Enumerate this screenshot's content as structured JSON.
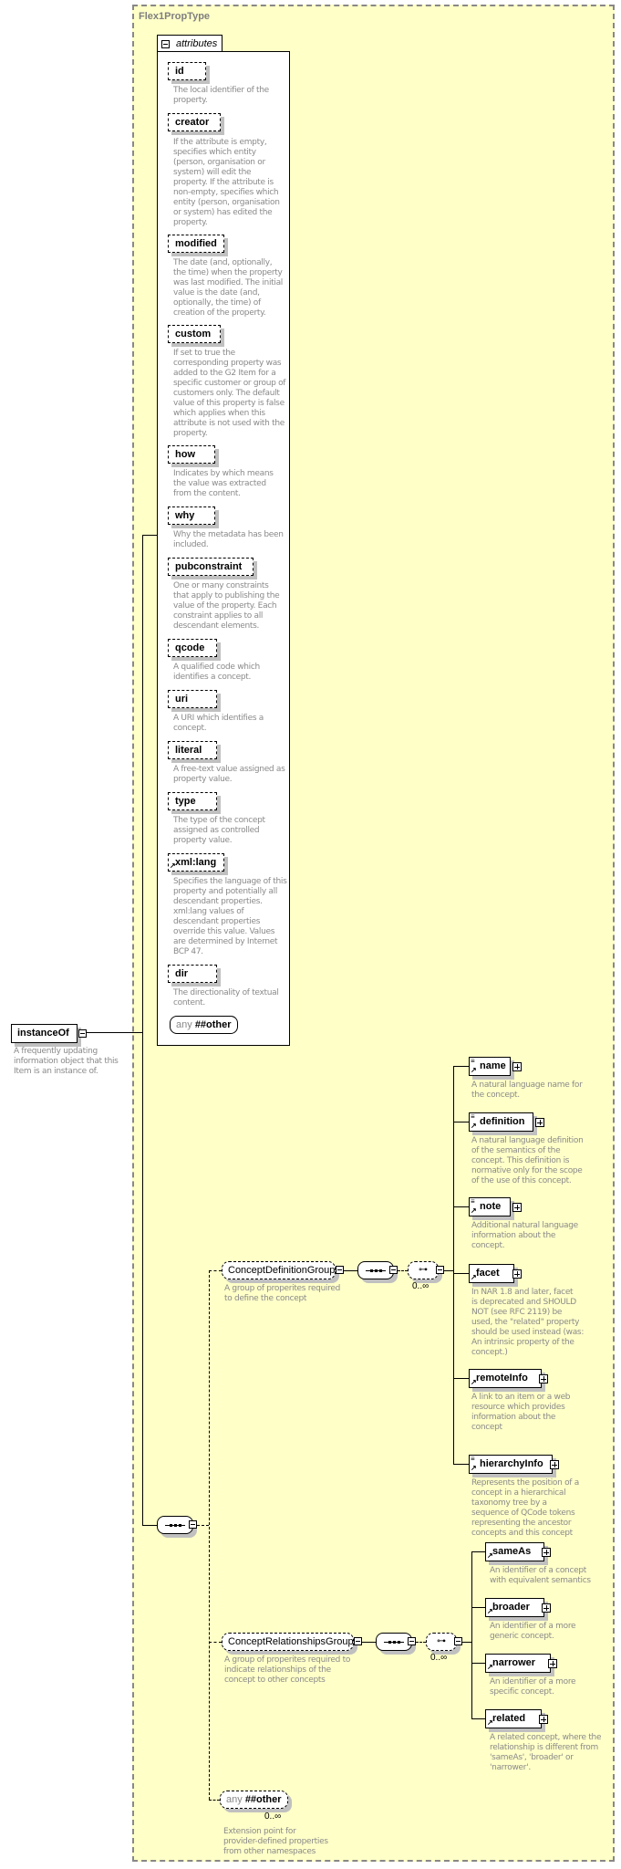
{
  "panel": {
    "title": "Flex1PropType"
  },
  "root": {
    "name": "instanceOf",
    "description": "A frequently updating\ninformation object that this\nItem is an instance of."
  },
  "attributes": {
    "label": "attributes",
    "items": [
      {
        "name": "id",
        "description": "The local identifier of the\nproperty."
      },
      {
        "name": "creator",
        "description": "If the attribute is empty,\nspecifies which entity\n(person, organisation or\nsystem) will edit the\nproperty. If the attribute is\nnon-empty, specifies which\nentity (person, organisation\nor system) has edited the\nproperty."
      },
      {
        "name": "modified",
        "description": "The date (and, optionally,\nthe time) when the property\nwas last modified. The initial\nvalue is the date (and,\noptionally, the time) of\ncreation of the property."
      },
      {
        "name": "custom",
        "description": "If set to true the\ncorresponding property was\nadded to the G2 Item for a\nspecific customer or group of\ncustomers only. The default\nvalue of this property is false\nwhich applies when this\nattribute is not used with the\nproperty."
      },
      {
        "name": "how",
        "description": "Indicates by which means\nthe value was extracted\nfrom the content."
      },
      {
        "name": "why",
        "description": "Why the metadata has been\nincluded."
      },
      {
        "name": "pubconstraint",
        "description": "One or many constraints\nthat apply to publishing the\nvalue of the property. Each\nconstraint applies to all\ndescendant elements."
      },
      {
        "name": "qcode",
        "description": "A qualified code which\nidentifies a concept."
      },
      {
        "name": "uri",
        "description": "A URI which identifies a\nconcept."
      },
      {
        "name": "literal",
        "description": "A free-text value assigned as\nproperty value."
      },
      {
        "name": "type",
        "description": "The type of the concept\nassigned as controlled\nproperty value."
      },
      {
        "name": "xml:lang",
        "description": "Specifies the language of this\nproperty and potentially all\ndescendant properties.\nxml:lang values of\ndescendant properties\noverride this value. Values\nare determined by Internet\nBCP 47."
      },
      {
        "name": "dir",
        "description": "The directionality of textual\ncontent."
      }
    ],
    "any": {
      "keyword": "any",
      "value": "##other"
    }
  },
  "definition_group": {
    "name": "ConceptDefinitionGroup",
    "description": "A group of properites required\nto define the concept",
    "cardinality": "0..∞",
    "children": [
      {
        "name": "name",
        "description": "A natural language name for\nthe concept."
      },
      {
        "name": "definition",
        "description": "A natural language definition\nof the semantics of the\nconcept. This definition is\nnormative only for the scope\nof the use of this concept."
      },
      {
        "name": "note",
        "description": "Additional natural language\ninformation about the\nconcept."
      },
      {
        "name": "facet",
        "description": "In NAR 1.8 and later, facet\nis deprecated and SHOULD\nNOT (see RFC 2119) be\nused, the \"related\" property\nshould be used instead (was:\nAn intrinsic property of the\nconcept.)"
      },
      {
        "name": "remoteInfo",
        "description": "A link to an item or a web\nresource which provides\ninformation about the\nconcept"
      },
      {
        "name": "hierarchyInfo",
        "description": "Represents the position of a\nconcept in a hierarchical\ntaxonomy tree by a\nsequence of QCode tokens\nrepresenting the ancestor\nconcepts and this concept"
      }
    ]
  },
  "relationships_group": {
    "name": "ConceptRelationshipsGroup",
    "description": "A group of properites required to\nindicate relationships of the\nconcept to other concepts",
    "cardinality": "0..∞",
    "children": [
      {
        "name": "sameAs",
        "description": "An identifier of a concept\nwith equivalent semantics"
      },
      {
        "name": "broader",
        "description": "An identifier of a more\ngeneric concept."
      },
      {
        "name": "narrower",
        "description": "An identifier of a more\nspecific concept."
      },
      {
        "name": "related",
        "description": "A related concept, where the\nrelationship is different from\n'sameAs', 'broader' or\n'narrower'."
      }
    ]
  },
  "any_other": {
    "keyword": "any",
    "value": "##other",
    "cardinality": "0..∞",
    "description": "Extension point for\nprovider-defined properties\nfrom other namespaces"
  }
}
